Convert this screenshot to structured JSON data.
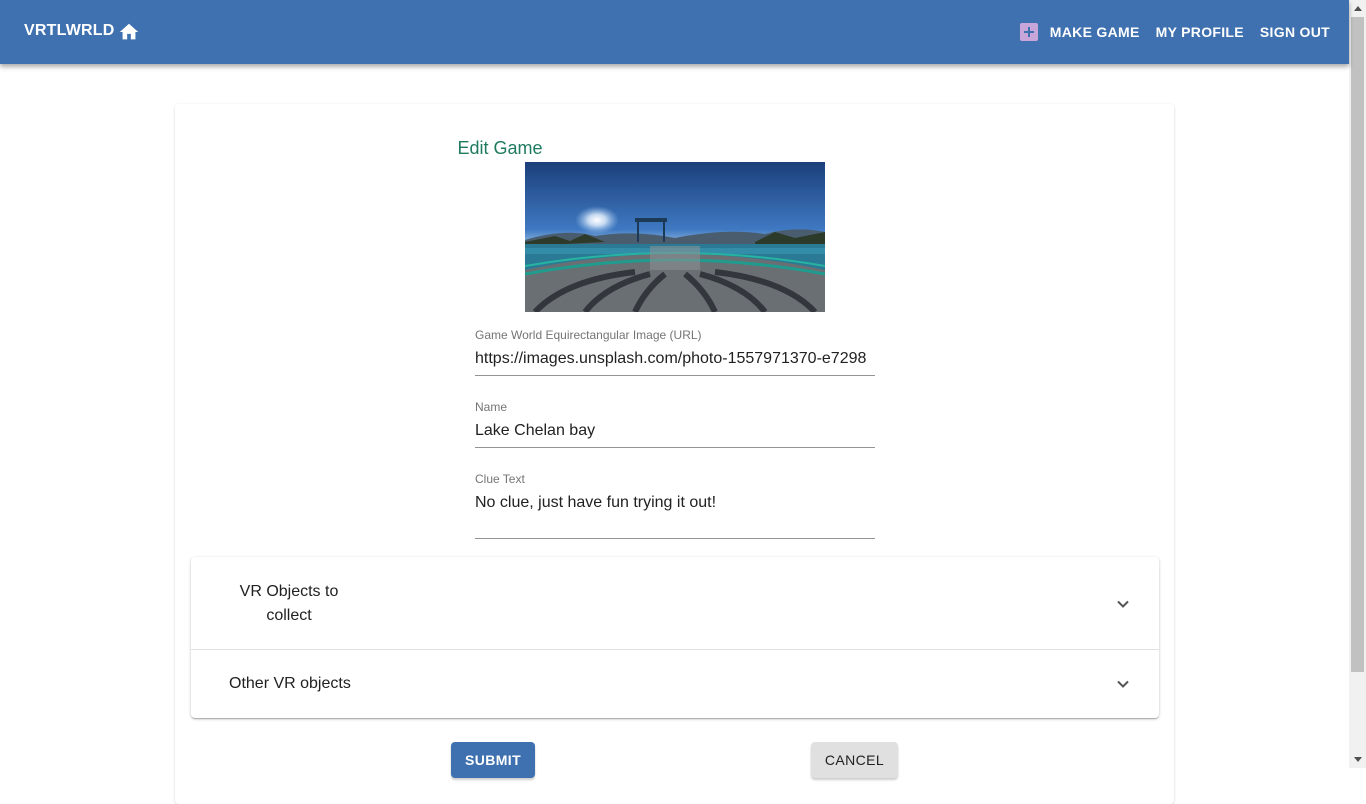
{
  "appbar": {
    "brand": "VRTLWRLD",
    "nav": {
      "make_game": "MAKE GAME",
      "my_profile": "MY PROFILE",
      "sign_out": "SIGN OUT"
    },
    "icons": [
      "home-icon",
      "add-box-icon"
    ],
    "color": "#3f71b0"
  },
  "form": {
    "title": "Edit Game",
    "image_url": {
      "label": "Game World Equirectangular Image (URL)",
      "value": "https://images.unsplash.com/photo-1557971370-e7298"
    },
    "name": {
      "label": "Name",
      "value": "Lake Chelan bay"
    },
    "clue": {
      "label": "Clue Text",
      "value": "No clue, just have fun trying it out!"
    }
  },
  "panels": [
    {
      "title": "VR Objects to collect"
    },
    {
      "title": "Other VR objects"
    }
  ],
  "actions": {
    "submit": "SUBMIT",
    "cancel": "CANCEL"
  },
  "colors": {
    "title": "#1f7a5f",
    "primary": "#3f71b0"
  }
}
